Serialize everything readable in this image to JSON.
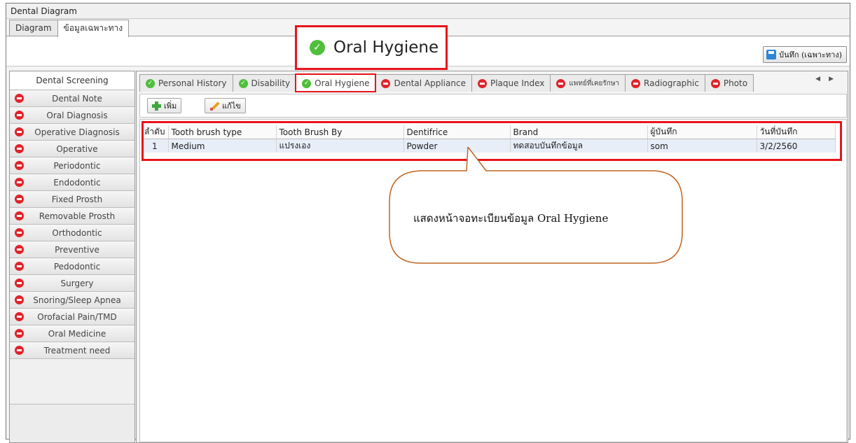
{
  "window": {
    "title": "Dental Diagram"
  },
  "outer_tabs": [
    {
      "label": "Diagram"
    },
    {
      "label": "ข้อมูลเฉพาะทาง"
    }
  ],
  "toolbar": {
    "save_label": "บันทึก (เฉพาะทาง)"
  },
  "overlay": {
    "title": "Oral Hygiene"
  },
  "left_panel": {
    "header": "Dental Screening",
    "items": [
      {
        "label": "Dental Note"
      },
      {
        "label": "Oral Diagnosis"
      },
      {
        "label": "Operative Diagnosis"
      },
      {
        "label": "Operative"
      },
      {
        "label": "Periodontic"
      },
      {
        "label": "Endodontic"
      },
      {
        "label": "Fixed Prosth"
      },
      {
        "label": "Removable Prosth"
      },
      {
        "label": "Orthodontic"
      },
      {
        "label": "Preventive"
      },
      {
        "label": "Pedodontic"
      },
      {
        "label": "Surgery"
      },
      {
        "label": "Snoring/Sleep Apnea"
      },
      {
        "label": "Orofacial Pain/TMD"
      },
      {
        "label": "Oral Medicine"
      },
      {
        "label": "Treatment need"
      }
    ]
  },
  "sub_tabs": [
    {
      "label": "Personal History",
      "status": "complete"
    },
    {
      "label": "Disability",
      "status": "complete"
    },
    {
      "label": "Oral Hygiene",
      "status": "complete"
    },
    {
      "label": "Dental Appliance",
      "status": "missing"
    },
    {
      "label": "Plaque Index",
      "status": "missing"
    },
    {
      "label": "แพทย์ที่เคยรักษา",
      "status": "missing"
    },
    {
      "label": "Radiographic",
      "status": "missing"
    },
    {
      "label": "Photo",
      "status": "missing"
    }
  ],
  "actions": {
    "add_label": "เพิ่ม",
    "edit_label": "แก้ไข"
  },
  "table": {
    "columns": [
      "ลำดับ",
      "Tooth brush type",
      "Tooth Brush By",
      "Dentifrice",
      "Brand",
      "ผู้บันทึก",
      "วันที่บันทึก"
    ],
    "rows": [
      [
        "1",
        "Medium",
        "แปรงเอง",
        "Powder",
        "ทดสอบบันทึกข้อมูล",
        "som",
        "3/2/2560"
      ]
    ]
  },
  "callout": {
    "text": "แสดงหน้าจอทะเบียนข้อมูล Oral Hygiene"
  },
  "colors": {
    "highlight": "#e8141b",
    "complete": "#4fbf3c",
    "missing": "#e0232a"
  }
}
